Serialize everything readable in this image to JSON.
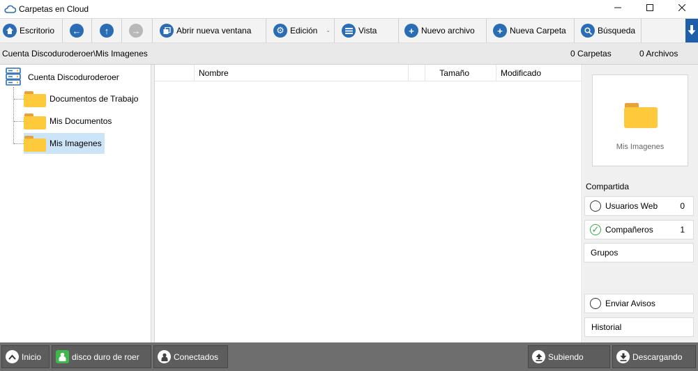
{
  "window": {
    "title": "Carpetas en Cloud"
  },
  "toolbar": {
    "desktop": "Escritorio",
    "new_window": "Abrir nueva ventana",
    "edit": "Edición",
    "view": "Vista",
    "new_file": "Nuevo archivo",
    "new_folder": "Nueva Carpeta",
    "search": "Búsqueda"
  },
  "pathbar": {
    "path": "Cuenta Discoduroderoer\\Mis Imagenes",
    "folders_count": "0 Carpetas",
    "files_count": "0 Archivos"
  },
  "tree": {
    "root": "Cuenta Discoduroderoer",
    "items": [
      {
        "label": "Documentos de Trabajo"
      },
      {
        "label": "Mis Documentos"
      },
      {
        "label": "Mis Imagenes",
        "selected": true
      }
    ]
  },
  "filelist": {
    "columns": [
      "",
      "Nombre",
      "",
      "Tamaño",
      "Modificado"
    ]
  },
  "rightpanel": {
    "preview_caption": "Mis Imagenes",
    "shared_title": "Compartida",
    "web_users_label": "Usuarios Web",
    "web_users_count": "0",
    "partners_label": "Compañeros",
    "partners_count": "1",
    "groups_label": "Grupos",
    "send_notices_label": "Enviar Avisos",
    "history_label": "Historial"
  },
  "statusbar": {
    "home": "Inicio",
    "drive": "disco duro de roer",
    "connected": "Conectados",
    "uploading": "Subiendo",
    "downloading": "Descargando"
  },
  "colors": {
    "accent": "#2a6db5",
    "folder": "#ffc93c",
    "selection": "#cce4f7",
    "status_bar": "#6e6e6e",
    "online": "#3db84b"
  },
  "icons": [
    "cloud-icon",
    "home-icon",
    "arrow-left-icon",
    "arrow-up-icon",
    "arrow-right-icon",
    "window-icon",
    "gear-icon",
    "list-icon",
    "plus-icon",
    "search-icon",
    "arrow-down-icon",
    "server-icon",
    "folder-icon",
    "user-icon",
    "upload-icon",
    "download-icon"
  ]
}
